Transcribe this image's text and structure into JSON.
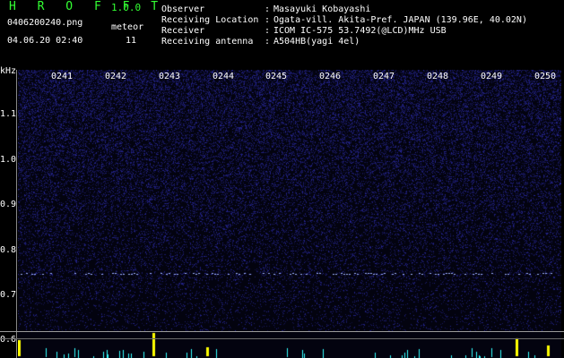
{
  "header": {
    "app_title": "H R O F F T",
    "app_version": "1.0.0",
    "file_name": "0406200240.png",
    "timestamp": "04.06.20 02:40",
    "meteor_label": "meteor",
    "meteor_count": "11"
  },
  "info": [
    {
      "key": "Observer",
      "value": "Masayuki Kobayashi"
    },
    {
      "key": "Receiving Location",
      "value": "Ogata-vill. Akita-Pref. JAPAN (139.96E, 40.02N)"
    },
    {
      "key": "Receiver",
      "value": "ICOM IC-575 53.7492(@LCD)MHz USB"
    },
    {
      "key": "Receiving antenna",
      "value": "A504HB(yagi 4el)"
    }
  ],
  "info_separator": ":",
  "axis": {
    "unit": "kHz",
    "time_ticks": [
      "0241",
      "0242",
      "0243",
      "0244",
      "0245",
      "0246",
      "0247",
      "0248",
      "0249",
      "0250"
    ],
    "freq_ticks": [
      "1.1",
      "1.0",
      "0.9",
      "0.8",
      "0.7",
      "0.6"
    ]
  },
  "colors": {
    "title_green": "#33ff33",
    "noise_blue": "#1a1a88",
    "signal_light": "#9db0ff",
    "meteor_yellow": "#ffff00",
    "bar_cyan": "#33ffff"
  }
}
